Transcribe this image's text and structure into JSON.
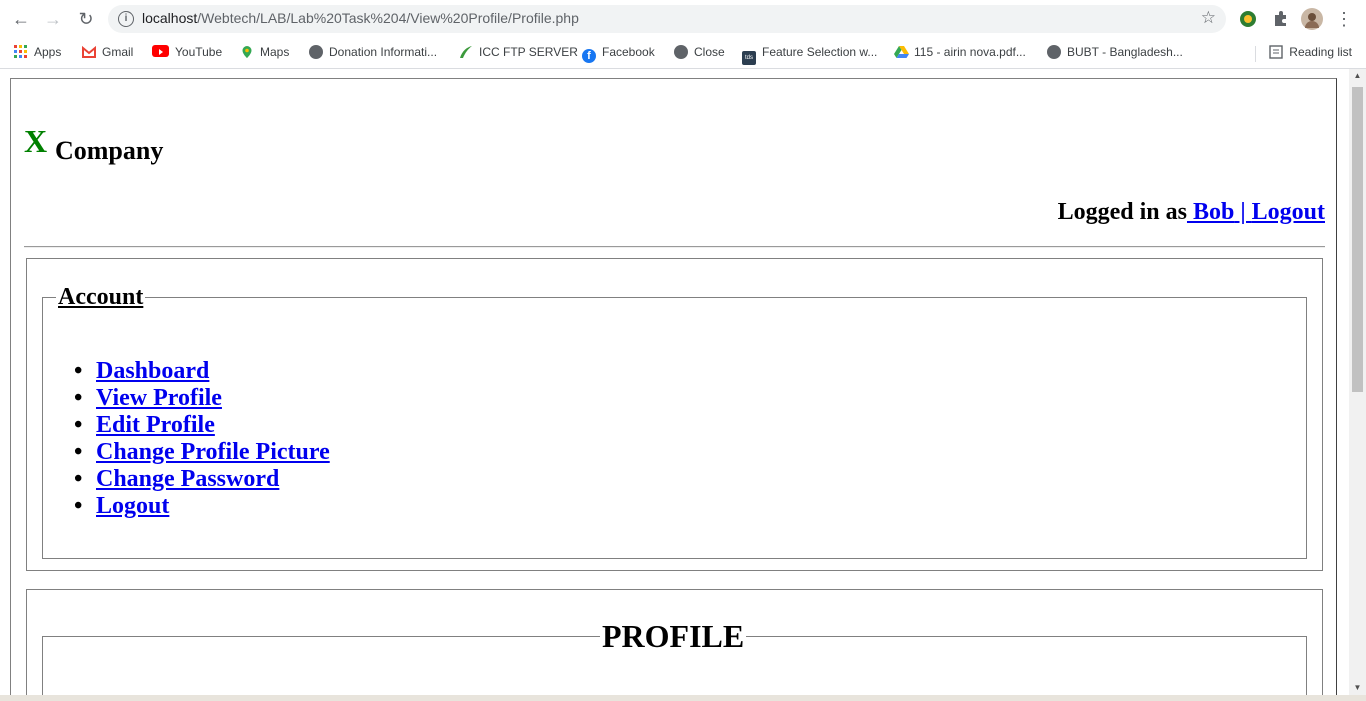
{
  "browser": {
    "url_host": "localhost",
    "url_path": "/Webtech/LAB/Lab%20Task%204/View%20Profile/Profile.php"
  },
  "bookmarks": [
    {
      "label": "Apps",
      "icon": "apps-grid-icon",
      "color": "#ea4335"
    },
    {
      "label": "Gmail",
      "icon": "gmail-icon",
      "color": "#ea4335"
    },
    {
      "label": "YouTube",
      "icon": "youtube-icon",
      "color": "#ff0000"
    },
    {
      "label": "Maps",
      "icon": "maps-pin-icon",
      "color": "#34a853"
    },
    {
      "label": "Donation Informati...",
      "icon": "globe-icon",
      "color": "#5f6368"
    },
    {
      "label": "ICC FTP SERVER",
      "icon": "ftp-leaf-icon",
      "color": "#3c9a3c"
    },
    {
      "label": "Facebook",
      "icon": "facebook-icon",
      "color": "#1877f2"
    },
    {
      "label": "Close",
      "icon": "globe-icon",
      "color": "#5f6368"
    },
    {
      "label": "Feature Selection w...",
      "icon": "tds-icon",
      "color": "#2c3e50"
    },
    {
      "label": "115 - airin nova.pdf...",
      "icon": "drive-icon",
      "color": "#fbbc04"
    },
    {
      "label": "BUBT - Bangladesh...",
      "icon": "globe-icon",
      "color": "#5f6368"
    }
  ],
  "reading_list": "Reading list",
  "page": {
    "logo_letter": "X",
    "company": "Company",
    "logged_in_prefix": "Logged in as",
    "user": " Bob",
    "separator": " | ",
    "logout": "Logout",
    "account_legend": "Account",
    "menu": [
      "Dashboard",
      "View Profile",
      "Edit Profile",
      "Change Profile Picture",
      "Change Password",
      "Logout"
    ],
    "profile_legend": "PROFILE"
  },
  "colors": {
    "link": "#0000ee",
    "logo": "#008000"
  }
}
